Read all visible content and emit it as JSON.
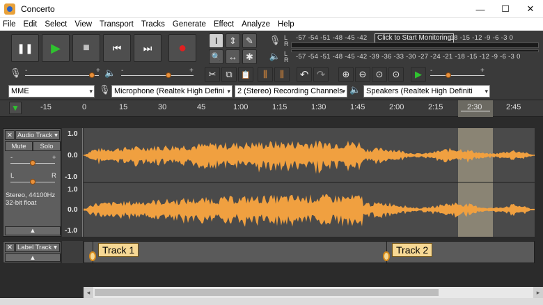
{
  "window": {
    "title": "Concerto",
    "minimize_icon": "—",
    "maximize_icon": "☐",
    "close_icon": "✕"
  },
  "menu": [
    "File",
    "Edit",
    "Select",
    "View",
    "Transport",
    "Tracks",
    "Generate",
    "Effect",
    "Analyze",
    "Help"
  ],
  "transport": {
    "pause": "❚❚",
    "play": "▶",
    "stop": "■",
    "skip_start": "⏮",
    "skip_end": "⏭",
    "record": "●"
  },
  "tools": {
    "select": "I",
    "envelope": "⇕",
    "draw": "✎",
    "zoom": "🔍",
    "timeshift": "↔",
    "multi": "✱"
  },
  "meters": {
    "scale": "-57 -54 -51 -48 -45 -42",
    "scale_right": "-18 -15 -12 -9 -6 -3 0",
    "playback_scale": "-57 -54 -51 -48 -45 -42 -39 -36 -33 -30 -27 -24 -21 -18 -15 -12 -9 -6 -3 0",
    "monitor_prompt": "Click to Start Monitoring",
    "left": "L",
    "right": "R"
  },
  "mixer": {
    "minus": "-",
    "plus": "+"
  },
  "edit_tools": {
    "cut": "✂",
    "copy": "⧉",
    "paste": "📋",
    "trim": "⫼",
    "silence": "⫼",
    "undo": "↶",
    "redo": "↷"
  },
  "zoom_tools": {
    "zoom_in": "⊕",
    "zoom_out": "⊖",
    "fit_sel": "⊙",
    "fit_proj": "⊙",
    "zoom_toggle": "⊙"
  },
  "play_at_speed": "▶",
  "devices": {
    "host": "MME",
    "input": "Microphone (Realtek High Defini",
    "channels": "2 (Stereo) Recording Channels",
    "output": "Speakers (Realtek High Definiti",
    "arrow": "▾"
  },
  "timeline": {
    "ticks": [
      "-15",
      "0",
      "15",
      "30",
      "45",
      "1:00",
      "1:15",
      "1:30",
      "1:45",
      "2:00",
      "2:15",
      "2:30",
      "2:45"
    ],
    "play_head_icon": "▼"
  },
  "audio_track": {
    "close": "✕",
    "name": "Audio Track",
    "menu_arrow": "▾",
    "mute": "Mute",
    "solo": "Solo",
    "gain_minus": "-",
    "gain_plus": "+",
    "pan_l": "L",
    "pan_r": "R",
    "info_rate": "Stereo, 44100Hz",
    "info_format": "32-bit float",
    "collapse": "▲",
    "scale": [
      "1.0",
      "0.0",
      "-1.0"
    ],
    "waveform_color": "#f0a040",
    "selection_color": "#8a8474"
  },
  "label_track": {
    "close": "✕",
    "name": "Label Track",
    "menu_arrow": "▾",
    "collapse": "▲",
    "labels": [
      "Track 1",
      "Track 2"
    ]
  }
}
